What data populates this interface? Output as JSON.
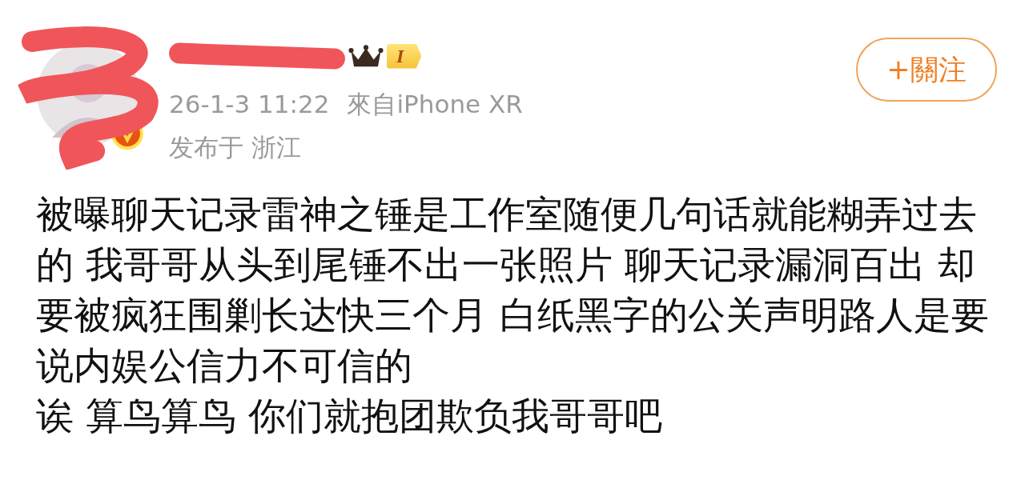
{
  "post": {
    "author": {
      "level_badge": "I"
    },
    "time": "26-1-3 11:22",
    "source": "來自iPhone XR",
    "location": "发布于 浙江",
    "follow_button": "+關注",
    "paragraphs": [
      "被曝聊天记录雷神之锤是工作室随便几句话就能糊弄过去的 我哥哥从头到尾锤不出一张照片 聊天记录漏洞百出 却要被疯狂围剿长达快三个月 白纸黑字的公关声明路人是要说内娱公信力不可信的",
      "诶 算鸟算鸟 你们就抱团欺负我哥哥吧"
    ]
  }
}
